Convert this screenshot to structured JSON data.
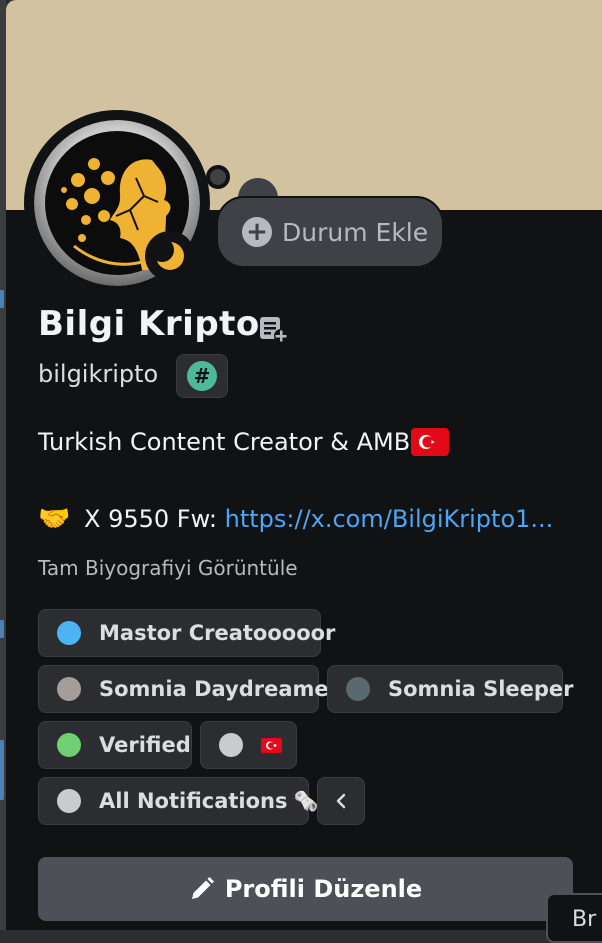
{
  "profile": {
    "display_name": "Bilgi Kripto",
    "username": "bilgikripto",
    "tag_symbol": "#",
    "add_status_label": "Durum Ekle",
    "add_status_icon": "plus-circle-icon"
  },
  "bio": {
    "line1": "Turkish Content Creator & AMB",
    "line1_flag": "turkey-flag-emoji",
    "line2_emoji": "🤝",
    "line2_text": " X 9550 Fw: ",
    "line2_link": "https://x.com/BilgiKripto1...",
    "view_full_label": "Tam Biyografiyi Görüntüle"
  },
  "roles": [
    {
      "name": "Mastor Creatooooor",
      "color": "#4cb3f5"
    },
    {
      "name": "Somnia Daydreamer",
      "color": "#a59d9a"
    },
    {
      "name": "Somnia Sleeper",
      "color": "#5a6970"
    },
    {
      "name": "Verified",
      "color": "#6fcf72"
    },
    {
      "name": "",
      "color": "#c9cbcf",
      "flag": "turkey-flag-emoji"
    },
    {
      "name": "All Notifications",
      "color": "#c9cbcf",
      "emoji": "🗞️"
    }
  ],
  "collapse_icon": "chevron-left-icon",
  "edit_profile_label": "Profili Düzenle",
  "edit_profile_icon": "pencil-icon",
  "tooltip_fragment": "Br",
  "colors": {
    "banner": "#d3c29f",
    "card_bg": "#111214",
    "link": "#4ca5f5",
    "accent_moon": "#f0b232"
  }
}
